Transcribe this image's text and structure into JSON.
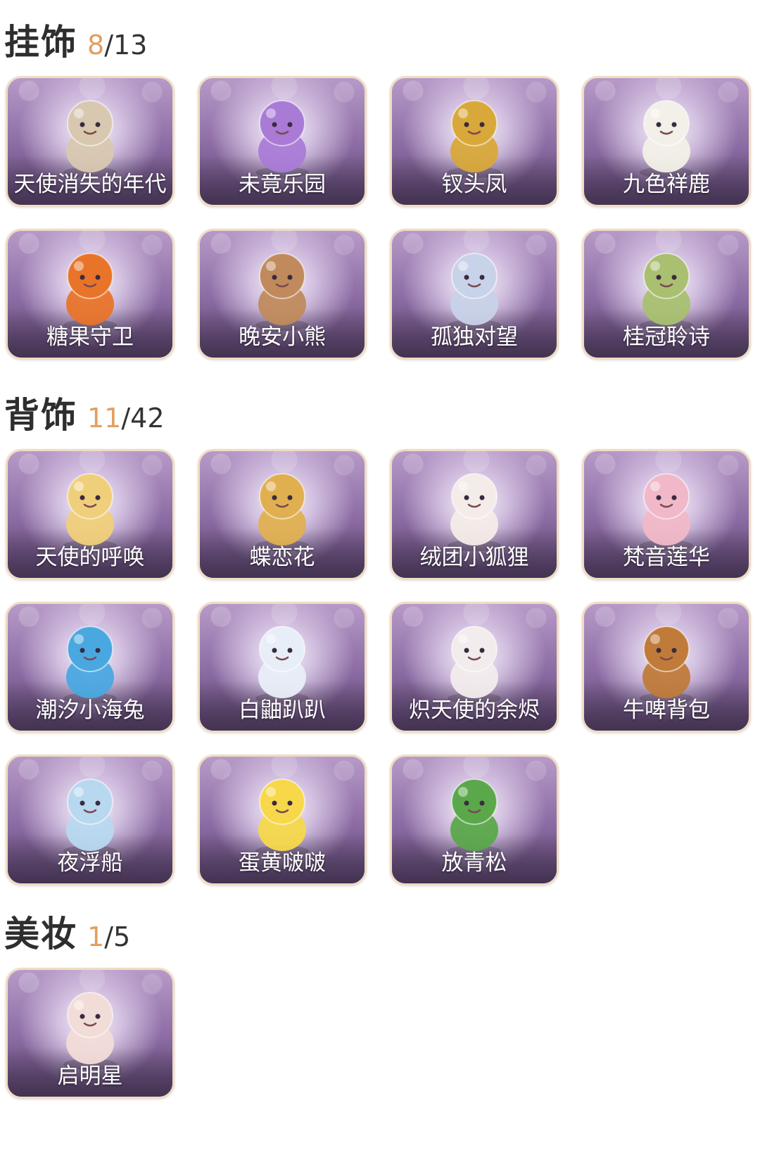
{
  "sections": [
    {
      "title": "挂饰",
      "owned": "8",
      "total": "/13",
      "items": [
        {
          "name": "天使消失的年代",
          "icon": "angel-veil-icon",
          "color": "#d8c8b0"
        },
        {
          "name": "未竟乐园",
          "icon": "purple-hair-girl-icon",
          "color": "#a97bd6"
        },
        {
          "name": "钗头凤",
          "icon": "phoenix-crown-icon",
          "color": "#d8a83a"
        },
        {
          "name": "九色祥鹿",
          "icon": "deer-icon",
          "color": "#f2f0e8"
        },
        {
          "name": "糖果守卫",
          "icon": "pumpkin-icon",
          "color": "#e8742a"
        },
        {
          "name": "晚安小熊",
          "icon": "bear-icon",
          "color": "#c08a5c"
        },
        {
          "name": "孤独对望",
          "icon": "silver-hair-doll-icon",
          "color": "#c8d2e8"
        },
        {
          "name": "桂冠聆诗",
          "icon": "laurel-doll-icon",
          "color": "#a8c070"
        }
      ]
    },
    {
      "title": "背饰",
      "owned": "11",
      "total": "/42",
      "items": [
        {
          "name": "天使的呼唤",
          "icon": "golden-angel-icon",
          "color": "#f0cf7a"
        },
        {
          "name": "蝶恋花",
          "icon": "bell-butterfly-icon",
          "color": "#e0b050"
        },
        {
          "name": "绒团小狐狸",
          "icon": "fox-icon",
          "color": "#f4ece8"
        },
        {
          "name": "梵音莲华",
          "icon": "lotus-doll-icon",
          "color": "#f0b8c8"
        },
        {
          "name": "潮汐小海兔",
          "icon": "blue-sea-bunny-icon",
          "color": "#4aa8e0"
        },
        {
          "name": "白鼬趴趴",
          "icon": "ferret-icon",
          "color": "#e8eef8"
        },
        {
          "name": "炽天使的余烬",
          "icon": "winged-girl-icon",
          "color": "#f2ecec"
        },
        {
          "name": "牛啤背包",
          "icon": "cow-barrel-icon",
          "color": "#c07a3a"
        },
        {
          "name": "夜浮船",
          "icon": "jellyfish-icon",
          "color": "#b8d8f0"
        },
        {
          "name": "蛋黄啵啵",
          "icon": "chick-egg-icon",
          "color": "#f6d84a"
        },
        {
          "name": "放青松",
          "icon": "bonsai-pine-icon",
          "color": "#5aa84a"
        }
      ]
    },
    {
      "title": "美妆",
      "owned": "1",
      "total": "/5",
      "items": [
        {
          "name": "启明星",
          "icon": "face-sparkle-icon",
          "color": "#f2dcd8"
        }
      ]
    }
  ]
}
